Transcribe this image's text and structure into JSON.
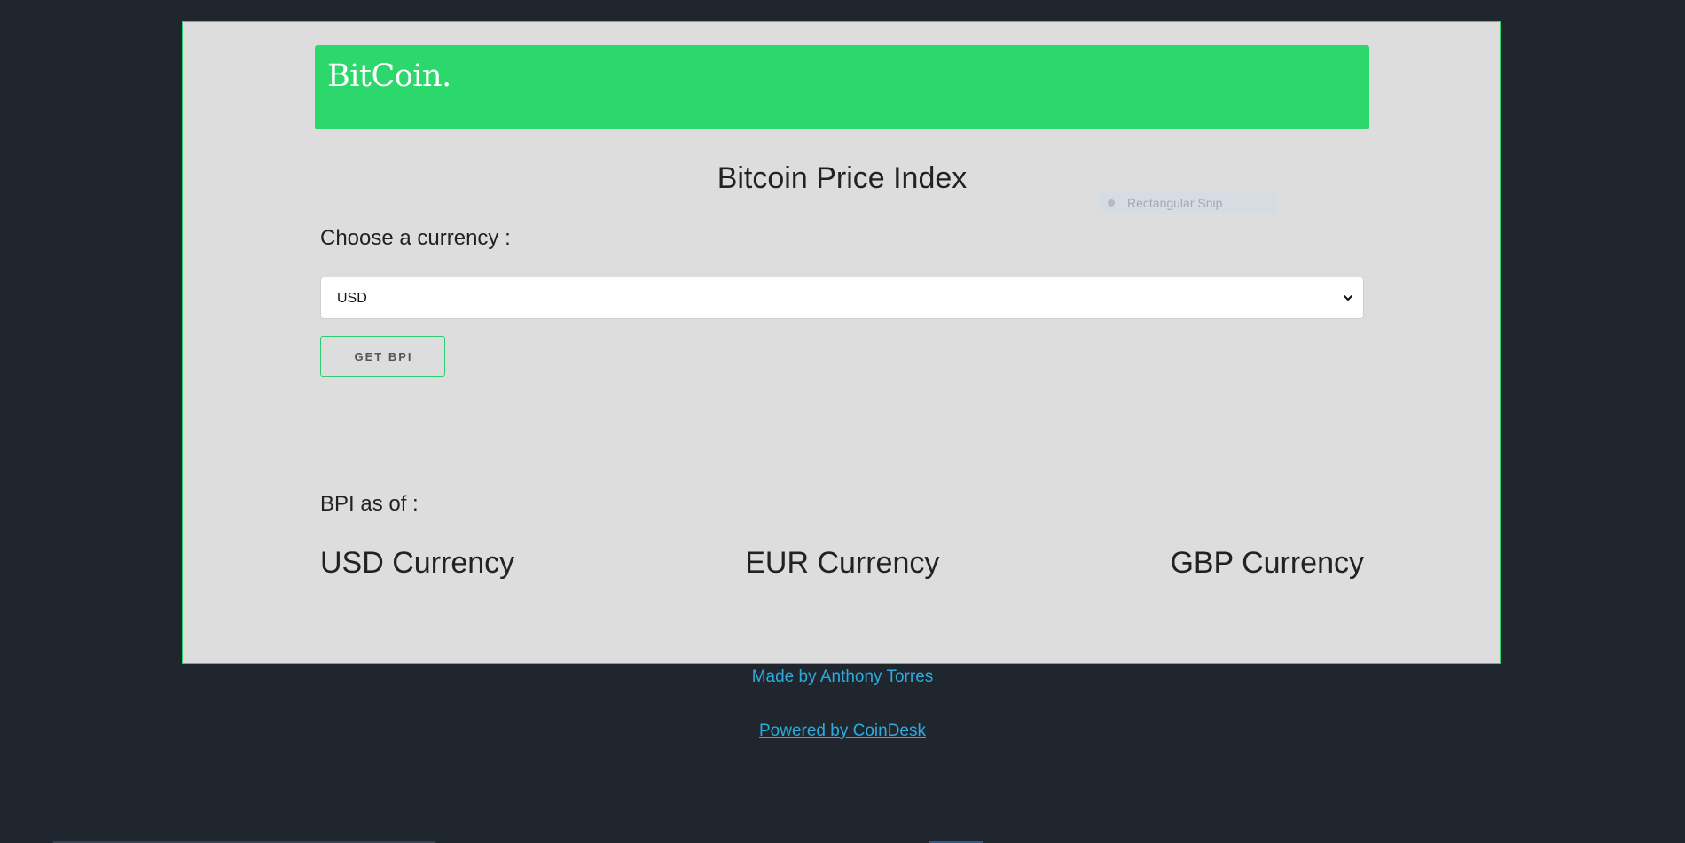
{
  "brand": {
    "logo_text": "BitCoin."
  },
  "page": {
    "title": "Bitcoin Price Index"
  },
  "overlay": {
    "snip_label": "Rectangular Snip"
  },
  "currency_picker": {
    "label": "Choose a currency :",
    "selected_value": "USD",
    "button_label": "GET BPI"
  },
  "results": {
    "bpi_label": "BPI as of :",
    "currencies": [
      "USD Currency",
      "EUR Currency",
      "GBP Currency"
    ]
  },
  "footer": {
    "made_by": "Made by Anthony Torres",
    "powered_by": "Powered by CoinDesk"
  },
  "colors": {
    "page_background": "#1f262e",
    "card_background": "#dddddd",
    "brand_green": "#2cd86c",
    "link_blue": "#2eaadc"
  }
}
